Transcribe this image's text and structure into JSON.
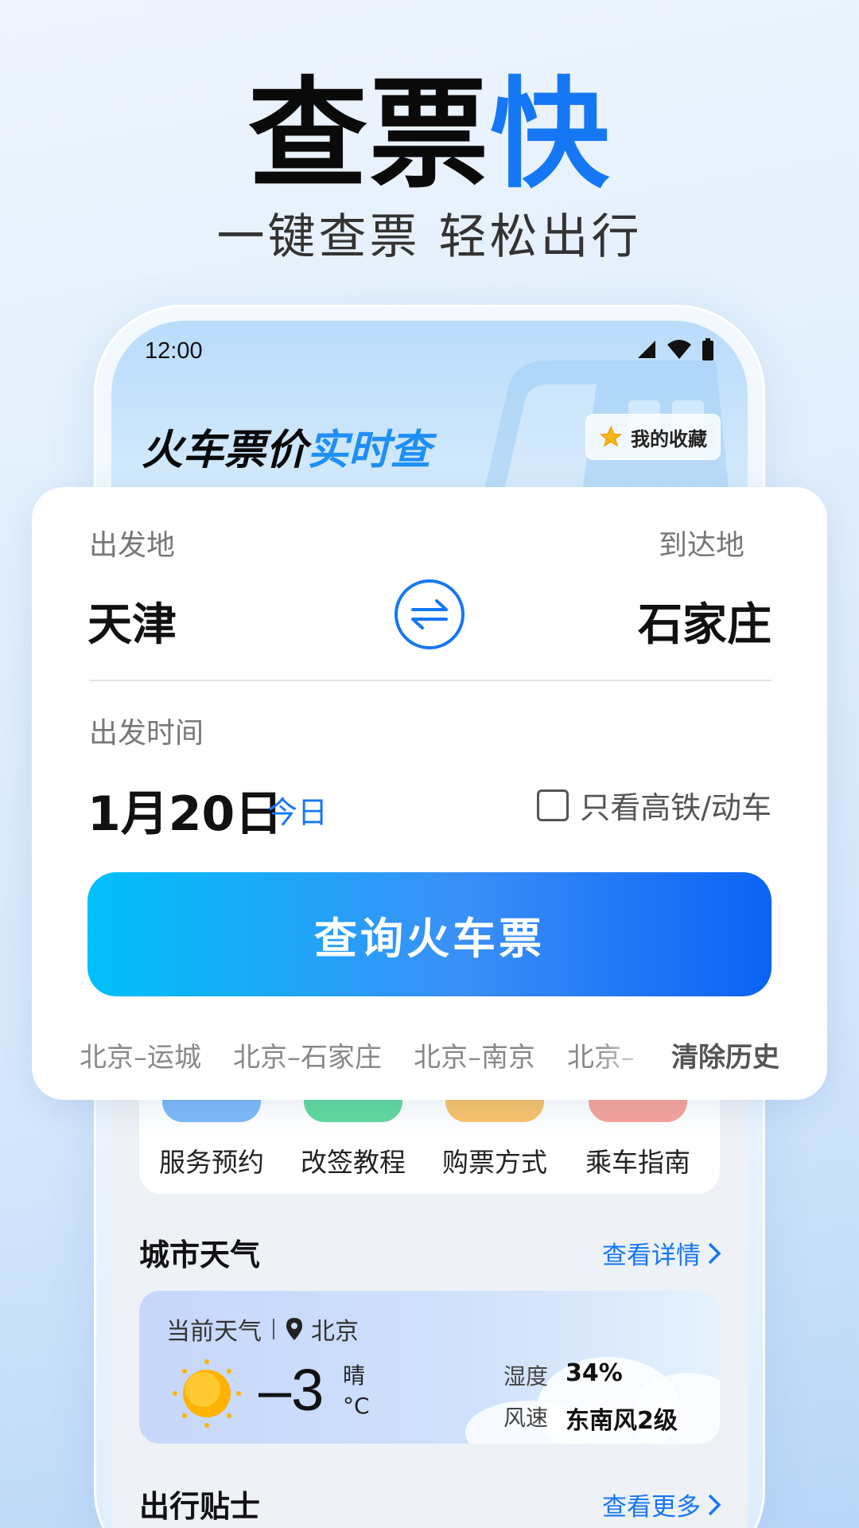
{
  "hero": {
    "title_main": "查票",
    "title_accent": "快",
    "subtitle": "一键查票 轻松出行"
  },
  "status_bar": {
    "time": "12:00"
  },
  "header": {
    "title_main": "火车票价",
    "title_accent": "实时查",
    "favorites_label": "我的收藏"
  },
  "search": {
    "from_label": "出发地",
    "to_label": "到达地",
    "from_city": "天津",
    "to_city": "石家庄",
    "date_label": "出发时间",
    "date": "1月20日",
    "today": "今日",
    "high_speed_only": "只看高铁/动车",
    "submit": "查询火车票",
    "history": [
      "北京–运城",
      "北京–石家庄",
      "北京–南京",
      "北京–"
    ],
    "clear_history": "清除历史"
  },
  "services": [
    {
      "label": "服务预约",
      "color": "#7db9f7"
    },
    {
      "label": "改签教程",
      "color": "#62d99d"
    },
    {
      "label": "购票方式",
      "color": "#f9c36b"
    },
    {
      "label": "乘车指南",
      "color": "#f7a39a"
    }
  ],
  "weather_section": {
    "title": "城市天气",
    "more": "查看详情",
    "current_label": "当前天气",
    "city": "北京",
    "temperature": "–3",
    "condition": "晴",
    "unit": "°C",
    "humidity_label": "湿度",
    "humidity": "34%",
    "wind_label": "风速",
    "wind": "东南风2级"
  },
  "tips_section": {
    "title": "出行贴士",
    "more": "查看更多"
  },
  "colors": {
    "accent": "#1677f5",
    "button_start": "#00c0fa",
    "button_end": "#0b63f5"
  }
}
